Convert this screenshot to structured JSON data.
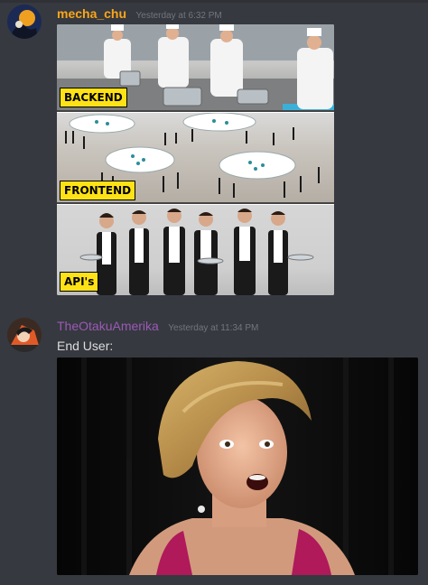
{
  "messages": [
    {
      "author": "mecha_chu",
      "author_color": "#faa61a",
      "timestamp": "Yesterday at 6:32 PM",
      "avatar_icon": "user-avatar-icon",
      "attachment": {
        "panels": [
          {
            "caption": "BACKEND"
          },
          {
            "caption": "FRONTEND"
          },
          {
            "caption": "API's"
          }
        ]
      }
    },
    {
      "author": "TheOtakuAmerika",
      "author_color": "#9b59b6",
      "timestamp": "Yesterday at 11:34 PM",
      "avatar_icon": "user-avatar-icon",
      "text": "End User:"
    }
  ],
  "theme": {
    "background": "#36393f",
    "timestamp_color": "#72767d",
    "text_color": "#dcddde",
    "caption_bg": "#ffe216"
  }
}
